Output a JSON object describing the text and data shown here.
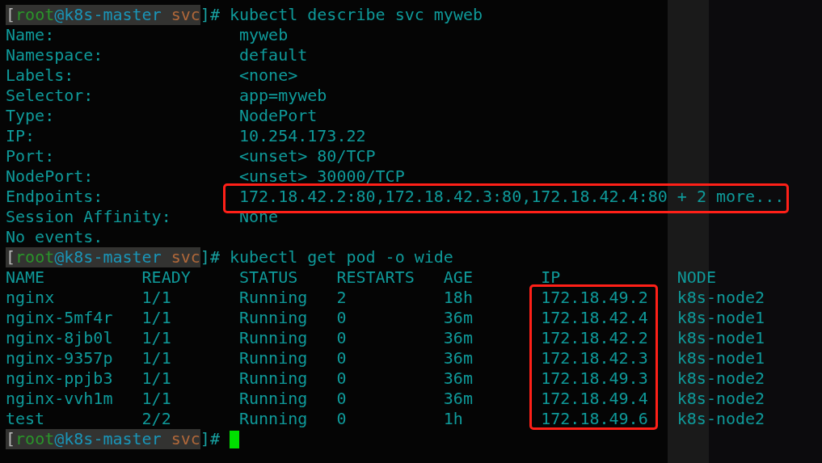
{
  "terminal": {
    "blocks": [
      {
        "kind": "describe",
        "prompt": {
          "open": "[",
          "user": "root",
          "host": "@k8s-master",
          "dir": "svc",
          "close": "]#"
        },
        "command": "kubectl describe svc myweb",
        "fields": [
          {
            "label": "Name:",
            "value": "myweb",
            "highlighted": false
          },
          {
            "label": "Namespace:",
            "value": "default",
            "highlighted": false
          },
          {
            "label": "Labels:",
            "value": "<none>",
            "highlighted": false
          },
          {
            "label": "Selector:",
            "value": "app=myweb",
            "highlighted": false
          },
          {
            "label": "Type:",
            "value": "NodePort",
            "highlighted": false
          },
          {
            "label": "IP:",
            "value": "10.254.173.22",
            "highlighted": false
          },
          {
            "label": "Port:",
            "value": "<unset> 80/TCP",
            "highlighted": false
          },
          {
            "label": "NodePort:",
            "value": "<unset> 30000/TCP",
            "highlighted": false
          },
          {
            "label": "Endpoints:",
            "value": "172.18.42.2:80,172.18.42.3:80,172.18.42.4:80 + 2 more...",
            "highlighted": true
          },
          {
            "label": "Session Affinity:",
            "value": "None",
            "highlighted": false
          }
        ],
        "footer": "No events."
      },
      {
        "kind": "table",
        "prompt": {
          "open": "[",
          "user": "root",
          "host": "@k8s-master",
          "dir": "svc",
          "close": "]#"
        },
        "command": "kubectl get pod -o wide",
        "columns": [
          {
            "title": "NAME",
            "highlighted": false
          },
          {
            "title": "READY",
            "highlighted": false
          },
          {
            "title": "STATUS",
            "highlighted": false
          },
          {
            "title": "RESTARTS",
            "highlighted": false
          },
          {
            "title": "AGE",
            "highlighted": false
          },
          {
            "title": "IP",
            "highlighted": true
          },
          {
            "title": "NODE",
            "highlighted": false
          }
        ],
        "rows": [
          [
            "nginx",
            "1/1",
            "Running",
            "2",
            "18h",
            "172.18.49.2",
            "k8s-node2"
          ],
          [
            "nginx-5mf4r",
            "1/1",
            "Running",
            "0",
            "36m",
            "172.18.42.4",
            "k8s-node1"
          ],
          [
            "nginx-8jb0l",
            "1/1",
            "Running",
            "0",
            "36m",
            "172.18.42.2",
            "k8s-node1"
          ],
          [
            "nginx-9357p",
            "1/1",
            "Running",
            "0",
            "36m",
            "172.18.42.3",
            "k8s-node1"
          ],
          [
            "nginx-ppjb3",
            "1/1",
            "Running",
            "0",
            "36m",
            "172.18.49.3",
            "k8s-node2"
          ],
          [
            "nginx-vvh1m",
            "1/1",
            "Running",
            "0",
            "36m",
            "172.18.49.4",
            "k8s-node2"
          ],
          [
            "test",
            "2/2",
            "Running",
            "0",
            "1h",
            "172.18.49.6",
            "k8s-node2"
          ]
        ]
      },
      {
        "kind": "prompt",
        "prompt": {
          "open": "[",
          "user": "root",
          "host": "@k8s-master",
          "dir": "svc",
          "close": "]#"
        },
        "cursor": true
      }
    ]
  }
}
